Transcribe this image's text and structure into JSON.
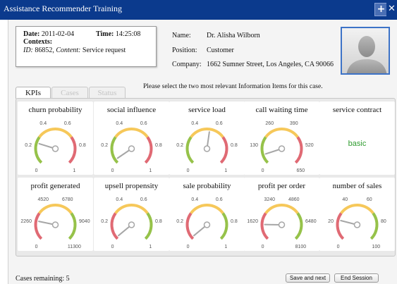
{
  "window": {
    "title": "Assistance Recommender Training"
  },
  "context": {
    "date_label": "Date:",
    "date_value": "2011-02-04",
    "time_label": "Time:",
    "time_value": "14:25:08",
    "contexts_label": "Contexts:",
    "id_label": "ID:",
    "id_value": "86852,",
    "content_label": "Content:",
    "content_value": "Service request"
  },
  "person": {
    "name_label": "Name:",
    "name_value": "Dr. Alisha Wilborn",
    "position_label": "Position:",
    "position_value": "Customer",
    "company_label": "Company:",
    "company_value": "1662 Sumner Street, Los Angeles, CA 90066"
  },
  "tabs": [
    {
      "label": "KPIs",
      "active": true
    },
    {
      "label": "Cases",
      "active": false
    },
    {
      "label": "Status",
      "active": false
    }
  ],
  "prompt": "Please select the two most relevant Information Items for this case.",
  "kpis": [
    {
      "title": "churn probability",
      "type": "gauge",
      "scheme": "gyr",
      "labels": [
        "0",
        "0.2",
        "0.4",
        "0.6",
        "0.8",
        "1"
      ],
      "value": 0.23
    },
    {
      "title": "social influence",
      "type": "gauge",
      "scheme": "gyr",
      "labels": [
        "0",
        "0.2",
        "0.4",
        "0.6",
        "0.8",
        "1"
      ],
      "value": 0.04
    },
    {
      "title": "service load",
      "type": "gauge",
      "scheme": "gyr",
      "labels": [
        "0",
        "0.2",
        "0.4",
        "0.6",
        "0.8",
        "1"
      ],
      "value": 0.53
    },
    {
      "title": "call waiting time",
      "type": "gauge",
      "scheme": "gyr",
      "labels": [
        "0",
        "130",
        "260",
        "390",
        "520",
        "650"
      ],
      "value": 0.1
    },
    {
      "title": "service contract",
      "type": "text",
      "text": "basic"
    },
    {
      "title": "profit generated",
      "type": "gauge",
      "scheme": "ryg",
      "labels": [
        "0",
        "2260",
        "4520",
        "6780",
        "9040",
        "11300"
      ],
      "value": 0.21
    },
    {
      "title": "upsell propensity",
      "type": "gauge",
      "scheme": "ryg",
      "labels": [
        "0",
        "0.2",
        "0.4",
        "0.6",
        "0.8",
        "1"
      ],
      "value": 0.02
    },
    {
      "title": "sale probability",
      "type": "gauge",
      "scheme": "ryg",
      "labels": [
        "0",
        "0.2",
        "0.4",
        "0.6",
        "0.8",
        "1"
      ],
      "value": 0.02
    },
    {
      "title": "profit per order",
      "type": "gauge",
      "scheme": "ryg",
      "labels": [
        "0",
        "1620",
        "3240",
        "4860",
        "6480",
        "8100"
      ],
      "value": 0.17
    },
    {
      "title": "number of sales",
      "type": "gauge",
      "scheme": "ryg",
      "labels": [
        "0",
        "20",
        "40",
        "60",
        "80",
        "100"
      ],
      "value": 0.22
    }
  ],
  "footer": {
    "cases_remaining": "Cases remaining: 5",
    "save_label": "Save and next",
    "end_label": "End Session"
  },
  "colors": {
    "titlebar": "#0b3a8d",
    "green": "#96c24a",
    "yellow": "#f6c85a",
    "red": "#e06a74",
    "needle": "#a6a6a6",
    "contract_text": "#2f9c2f"
  }
}
